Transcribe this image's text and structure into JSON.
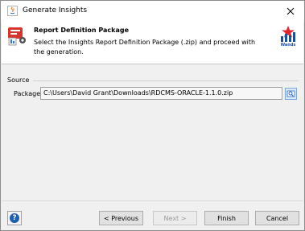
{
  "window": {
    "title": "Generate Insights"
  },
  "header": {
    "title": "Report Definition Package",
    "description": "Select the Insights Report Definition Package (.zip) and proceed with the generation.",
    "brand_label": "Wands",
    "icon": "package-icon"
  },
  "source": {
    "section_label": "Source",
    "package_label": "Package",
    "package_value": "C:\\Users\\David Grant\\Downloads\\RDCMS-ORACLE-1.1.0.zip"
  },
  "footer": {
    "previous_label": "< Previous",
    "next_label": "Next >",
    "finish_label": "Finish",
    "cancel_label": "Cancel"
  }
}
